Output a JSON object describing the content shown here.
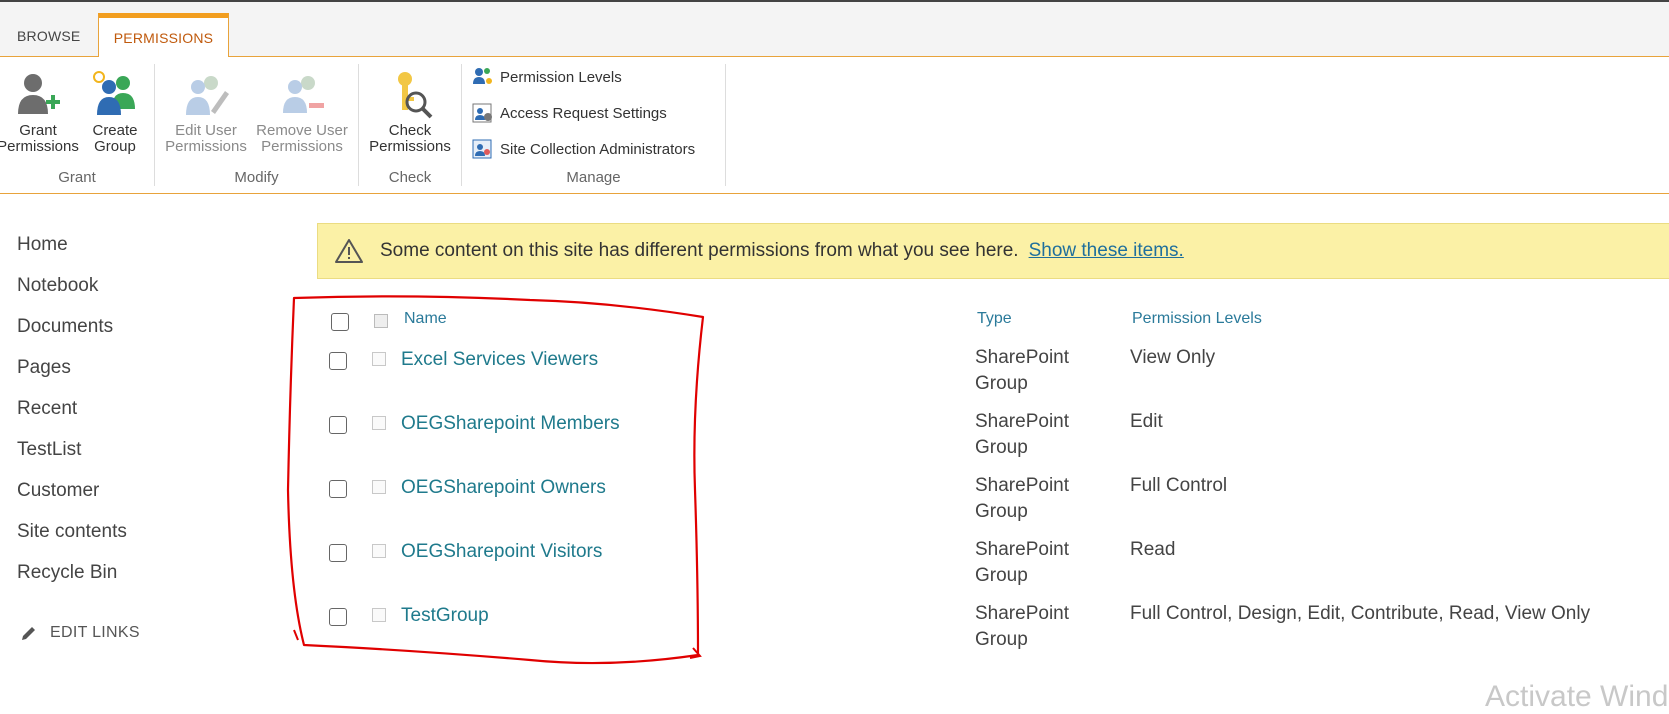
{
  "tabs": {
    "browse": "BROWSE",
    "permissions": "PERMISSIONS"
  },
  "ribbon": {
    "grant": {
      "label": "Grant",
      "grant_permissions": [
        "Grant",
        "Permissions"
      ],
      "create_group": [
        "Create",
        "Group"
      ]
    },
    "modify": {
      "label": "Modify",
      "edit_user": [
        "Edit User",
        "Permissions"
      ],
      "remove_user": [
        "Remove User",
        "Permissions"
      ]
    },
    "check": {
      "label": "Check",
      "check_permissions": [
        "Check",
        "Permissions"
      ]
    },
    "manage": {
      "label": "Manage",
      "permission_levels": "Permission Levels",
      "access_request": "Access Request Settings",
      "site_admins": "Site Collection Administrators"
    }
  },
  "quicklaunch": [
    "Home",
    "Notebook",
    "Documents",
    "Pages",
    "Recent",
    "TestList",
    "Customer",
    "Site contents",
    "Recycle Bin"
  ],
  "edit_links": "EDIT LINKS",
  "banner": {
    "text": "Some content on this site has different permissions from what you see here.",
    "link": "Show these items."
  },
  "table": {
    "headers": {
      "name": "Name",
      "type": "Type",
      "levels": "Permission Levels"
    },
    "rows": [
      {
        "name": "Excel Services Viewers",
        "type": [
          "SharePoint",
          "Group"
        ],
        "levels": "View Only"
      },
      {
        "name": "OEGSharepoint Members",
        "type": [
          "SharePoint",
          "Group"
        ],
        "levels": "Edit"
      },
      {
        "name": "OEGSharepoint Owners",
        "type": [
          "SharePoint",
          "Group"
        ],
        "levels": "Full Control"
      },
      {
        "name": "OEGSharepoint Visitors",
        "type": [
          "SharePoint",
          "Group"
        ],
        "levels": "Read"
      },
      {
        "name": "TestGroup",
        "type": [
          "SharePoint",
          "Group"
        ],
        "levels": "Full Control, Design, Edit, Contribute, Read, View Only"
      }
    ]
  },
  "watermark": "Activate Wind",
  "colors": {
    "accent": "#f29e1f",
    "link": "#1f7a8c",
    "banner": "#fbf1a6",
    "annotation": "#e00000"
  }
}
